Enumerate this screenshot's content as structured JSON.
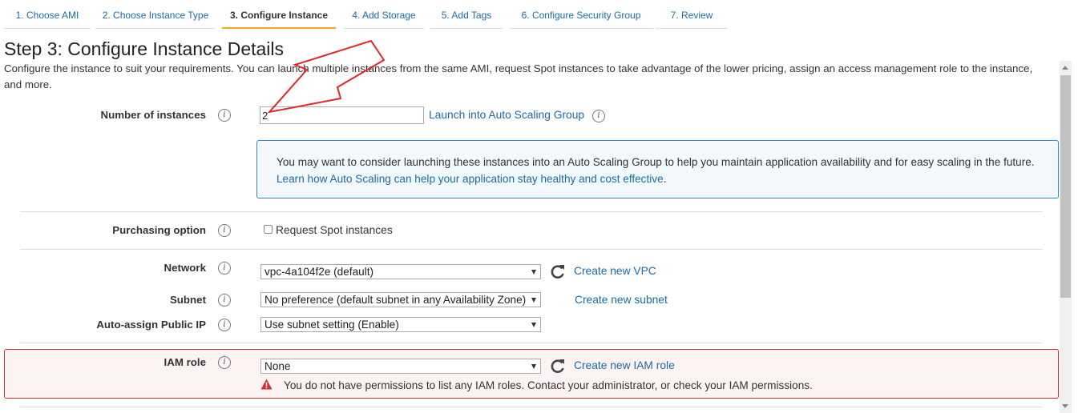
{
  "wizard": {
    "tabs": [
      {
        "label": "1. Choose AMI"
      },
      {
        "label": "2. Choose Instance Type"
      },
      {
        "label": "3. Configure Instance"
      },
      {
        "label": "4. Add Storage"
      },
      {
        "label": "5. Add Tags"
      },
      {
        "label": "6. Configure Security Group"
      },
      {
        "label": "7. Review"
      }
    ],
    "active_index": 2
  },
  "page": {
    "title": "Step 3: Configure Instance Details",
    "intro": "Configure the instance to suit your requirements. You can launch multiple instances from the same AMI, request Spot instances to take advantage of the lower pricing, assign an access management role to the instance, and more."
  },
  "instances": {
    "label": "Number of instances",
    "value": "2",
    "asg_link": "Launch into Auto Scaling Group"
  },
  "callout": {
    "text": "You may want to consider launching these instances into an Auto Scaling Group to help you maintain application availability and for easy scaling in the future.",
    "link": "Learn how Auto Scaling can help your application stay healthy and cost effective",
    "suffix": "."
  },
  "purchasing": {
    "label": "Purchasing option",
    "checkbox_label": "Request Spot instances",
    "checked": false
  },
  "network": {
    "label": "Network",
    "selected": "vpc-4a104f2e (default)",
    "create_link": "Create new VPC"
  },
  "subnet": {
    "label": "Subnet",
    "selected": "No preference (default subnet in any Availability Zone)",
    "create_link": "Create new subnet"
  },
  "public_ip": {
    "label": "Auto-assign Public IP",
    "selected": "Use subnet setting (Enable)"
  },
  "iam": {
    "label": "IAM role",
    "selected": "None",
    "create_link": "Create new IAM role",
    "error": "You do not have permissions to list any IAM roles. Contact your administrator, or check your IAM permissions."
  },
  "icons": {
    "info": "i",
    "refresh": "refresh-icon",
    "warning": "warning-triangle-icon",
    "annotation": "red-arrow-annotation"
  },
  "colors": {
    "link": "#1a6aab",
    "active_tab_underline": "#f5a623",
    "error_border": "#d0302f",
    "callout_border": "#2a8bc6",
    "annotation_arrow": "#e0262b"
  }
}
